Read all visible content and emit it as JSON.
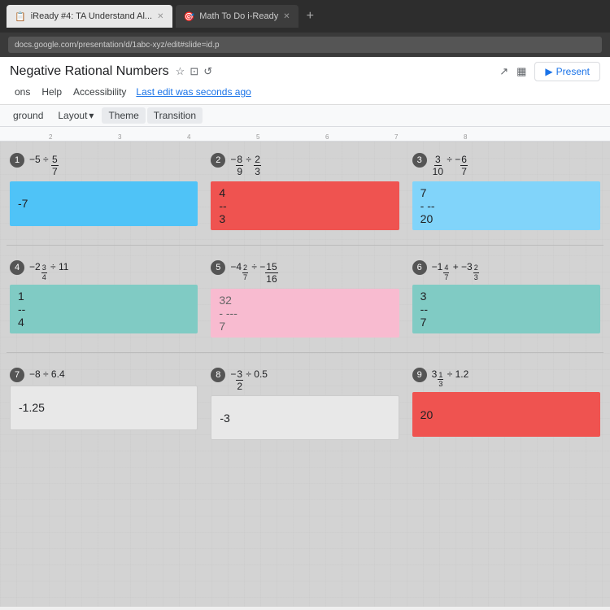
{
  "browser": {
    "tabs": [
      {
        "label": "iReady #4: TA  Understand Al...",
        "active": true,
        "icon": "📋"
      },
      {
        "label": "Math To Do  i-Ready",
        "active": false,
        "icon": "🎯"
      }
    ],
    "address": "docs.google.com/presentation/d/1abc-xyz/edit#slide=id.p",
    "new_tab_label": "+"
  },
  "slides": {
    "title": "Negative Rational Numbers",
    "menu_items": [
      "ons",
      "Help",
      "Accessibility"
    ],
    "last_edit": "Last edit was seconds ago",
    "toolbar": {
      "background_label": "ground",
      "layout_label": "Layout",
      "layout_arrow": "▾",
      "theme_label": "Theme",
      "transition_label": "Transition"
    },
    "present_label": "Present"
  },
  "ruler": {
    "marks": [
      "2",
      "3",
      "4",
      "5",
      "6",
      "7",
      "8"
    ]
  },
  "problems": [
    {
      "num": "1",
      "expr": "-5 ÷ 5/7",
      "answer_top": "-7",
      "answer_mid": "",
      "answer_bot": "",
      "box_color": "blue"
    },
    {
      "num": "2",
      "expr": "-8/9 ÷ 2/3",
      "answer_top": "4",
      "answer_mid": "--",
      "answer_bot": "3",
      "box_color": "red"
    },
    {
      "num": "3",
      "expr": "3/10 ÷ -6/7",
      "answer_top": "7",
      "answer_mid": "- --",
      "answer_bot": "20",
      "box_color": "light-blue"
    },
    {
      "num": "4",
      "expr": "-2 3/4 ÷ 11",
      "answer_top": "1",
      "answer_mid": "--",
      "answer_bot": "4",
      "box_color": "teal"
    },
    {
      "num": "5",
      "expr": "-4 2/7 ÷ -15/16",
      "answer_top": "32",
      "answer_mid": "- ---",
      "answer_bot": "7",
      "box_color": "pink"
    },
    {
      "num": "6",
      "expr": "-1 4/7 + -3 2/3",
      "answer_top": "3",
      "answer_mid": "--",
      "answer_bot": "7",
      "box_color": "teal"
    },
    {
      "num": "7",
      "expr": "-8 ÷ 6.4",
      "answer_top": "-1.25",
      "answer_mid": "",
      "answer_bot": "",
      "box_color": "none"
    },
    {
      "num": "8",
      "expr": "-3/2 ÷ 0.5",
      "answer_top": "-3",
      "answer_mid": "",
      "answer_bot": "",
      "box_color": "none"
    },
    {
      "num": "9",
      "expr": "3 1/3 ÷ 1.2",
      "answer_top": "20",
      "answer_mid": "",
      "answer_bot": "",
      "box_color": "red"
    }
  ]
}
